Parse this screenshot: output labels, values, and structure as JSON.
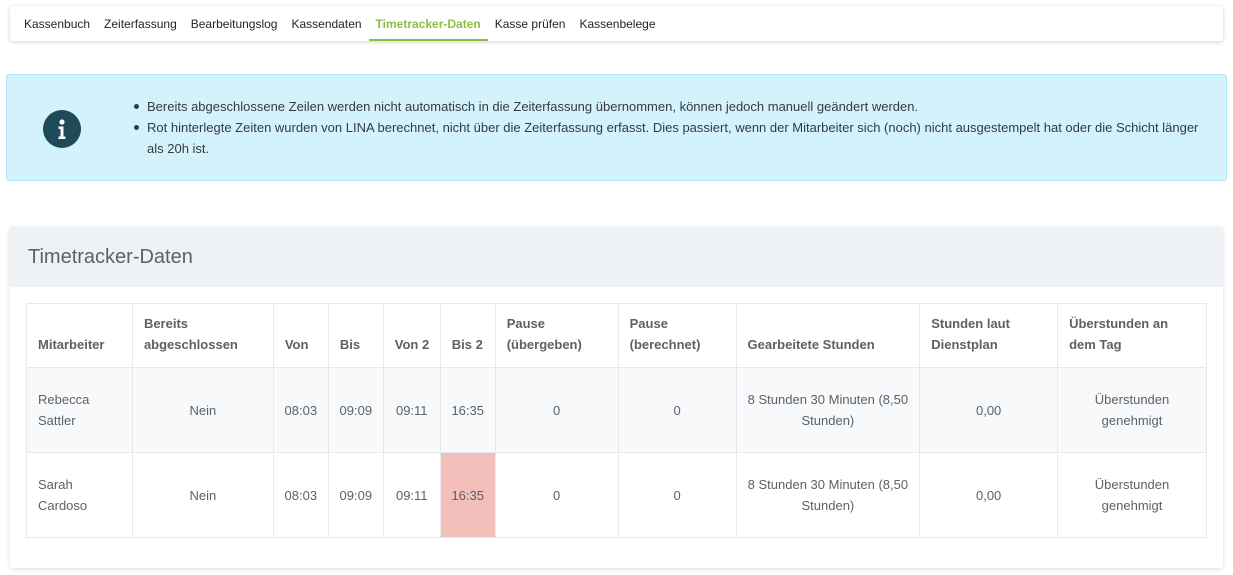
{
  "tabs": [
    {
      "label": "Kassenbuch",
      "active": false
    },
    {
      "label": "Zeiterfassung",
      "active": false
    },
    {
      "label": "Bearbeitungslog",
      "active": false
    },
    {
      "label": "Kassendaten",
      "active": false
    },
    {
      "label": "Timetracker-Daten",
      "active": true
    },
    {
      "label": "Kasse prüfen",
      "active": false
    },
    {
      "label": "Kassenbelege",
      "active": false
    }
  ],
  "info": {
    "icon": "info-circle-icon",
    "bullets": [
      "Bereits abgeschlossene Zeilen werden nicht automatisch in die Zeiterfassung übernommen, können jedoch manuell geändert werden.",
      "Rot hinterlegte Zeiten wurden von LINA berechnet, nicht über die Zeiterfassung erfasst. Dies passiert, wenn der Mitarbeiter sich (noch) nicht ausgestempelt hat oder die Schicht länger als 20h ist."
    ]
  },
  "card": {
    "title": "Timetracker-Daten"
  },
  "table": {
    "headers": [
      "Mitarbeiter",
      "Bereits abgeschlossen",
      "Von",
      "Bis",
      "Von 2",
      "Bis 2",
      "Pause (übergeben)",
      "Pause (berechnet)",
      "Gearbeitete Stunden",
      "Stunden laut Dienstplan",
      "Überstunden an dem Tag"
    ],
    "rows": [
      {
        "mitarbeiter": "Rebecca Sattler",
        "abgeschlossen": "Nein",
        "von": "08:03",
        "bis": "09:09",
        "von2": "09:11",
        "bis2": "16:35",
        "pause_uebergeben": "0",
        "pause_berechnet": "0",
        "gearbeitet": "8 Stunden 30 Minuten (8,50 Stunden)",
        "dienstplan": "0,00",
        "ueberstunden": "Überstunden genehmigt"
      },
      {
        "mitarbeiter": "Sarah Cardoso",
        "abgeschlossen": "Nein",
        "von": "08:03",
        "bis": "09:09",
        "von2": "09:11",
        "bis2": "16:35",
        "pause_uebergeben": "0",
        "pause_berechnet": "0",
        "gearbeitet": "8 Stunden 30 Minuten (8,50 Stunden)",
        "dienstplan": "0,00",
        "ueberstunden": "Überstunden genehmigt"
      }
    ],
    "highlight_color": "#f4bfbb"
  },
  "colors": {
    "accent": "#8cbf3f",
    "info_bg": "#d4f2fb",
    "info_icon": "#1e4a5a"
  }
}
